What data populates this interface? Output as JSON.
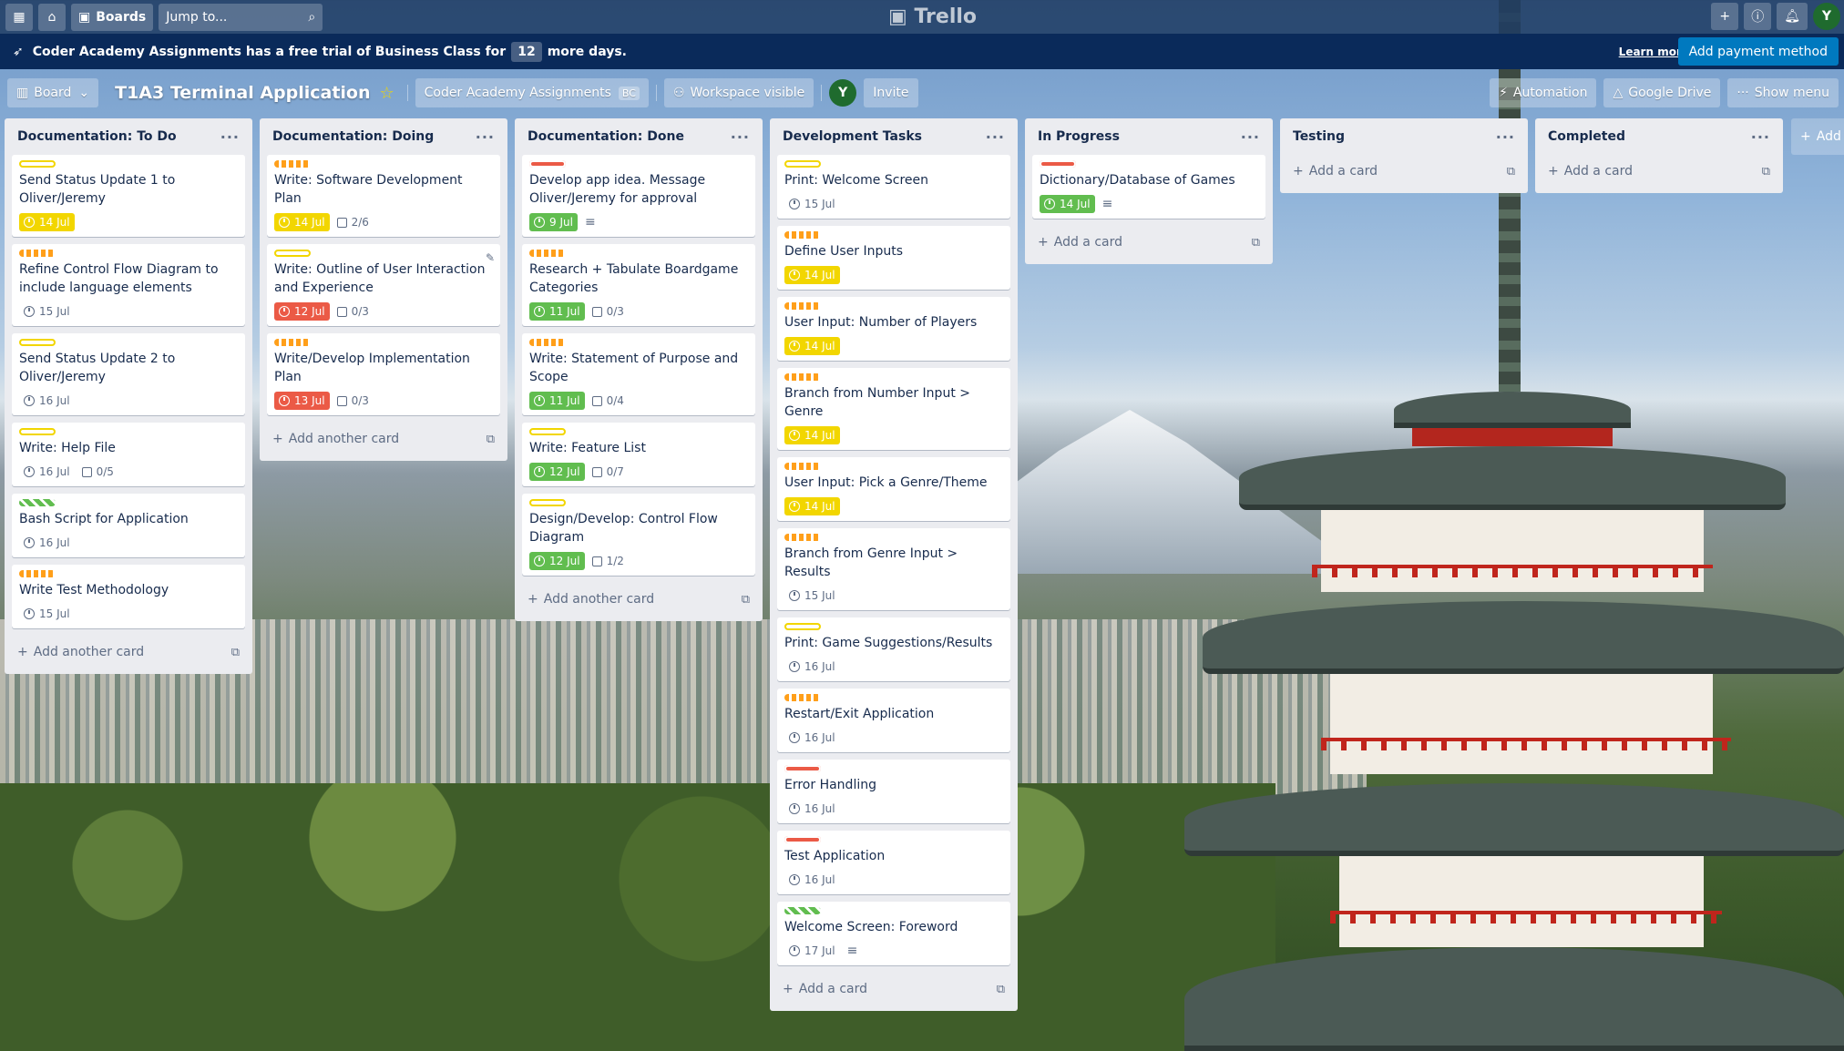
{
  "topbar": {
    "apps_icon": "grid-icon",
    "home_icon": "home-icon",
    "boards_label": "Boards",
    "search_placeholder": "Jump to...",
    "logo": "Trello",
    "right_icons": [
      "plus-icon",
      "info-icon",
      "bell-icon"
    ],
    "avatar_initial": "Y"
  },
  "banner": {
    "text_before": "Coder Academy Assignments has a free trial of Business Class for",
    "days": "12",
    "text_after": "more days.",
    "learn_more": "Learn more",
    "payment_button": "Add payment method"
  },
  "board_header": {
    "view_label": "Board",
    "title": "T1A3 Terminal Application",
    "workspace": "Coder Academy Assignments",
    "workspace_badge": "BC",
    "visibility": "Workspace visible",
    "member_initial": "Y",
    "invite": "Invite",
    "automation": "Automation",
    "google_drive": "Google Drive",
    "show_menu": "Show menu"
  },
  "colors": {
    "yellow": "#f2d600",
    "orange": "#ff9f1a",
    "red": "#eb5a46",
    "green": "#61bd4f",
    "list_bg": "#ebecf0",
    "payment": "#0079bf"
  },
  "lists": [
    {
      "title": "Documentation: To Do",
      "add_label": "Add another card",
      "cards": [
        {
          "label": "yellow",
          "title": "Send Status Update 1 to Oliver/Jeremy",
          "due": "14 Jul",
          "due_style": "yellow",
          "checklist": ""
        },
        {
          "label": "orange",
          "title": "Refine Control Flow Diagram to include language elements",
          "due": "15 Jul",
          "due_style": "plain",
          "checklist": ""
        },
        {
          "label": "yellow",
          "title": "Send Status Update 2 to Oliver/Jeremy",
          "due": "16 Jul",
          "due_style": "plain",
          "checklist": ""
        },
        {
          "label": "yellow",
          "title": "Write: Help File",
          "due": "16 Jul",
          "due_style": "plain",
          "checklist": "0/5"
        },
        {
          "label": "green",
          "title": "Bash Script for Application",
          "due": "16 Jul",
          "due_style": "plain",
          "checklist": ""
        },
        {
          "label": "orange",
          "title": "Write Test Methodology",
          "due": "15 Jul",
          "due_style": "plain",
          "checklist": ""
        }
      ]
    },
    {
      "title": "Documentation: Doing",
      "add_label": "Add another card",
      "cards": [
        {
          "label": "orange",
          "title": "Write: Software Development Plan",
          "due": "14 Jul",
          "due_style": "yellow",
          "checklist": "2/6"
        },
        {
          "label": "yellow",
          "title": "Write: Outline of User Interaction and Experience",
          "due": "12 Jul",
          "due_style": "red",
          "checklist": "0/3"
        },
        {
          "label": "orange",
          "title": "Write/Develop Implementation Plan",
          "due": "13 Jul",
          "due_style": "red",
          "checklist": "0/3"
        }
      ]
    },
    {
      "title": "Documentation: Done",
      "add_label": "Add another card",
      "cards": [
        {
          "label": "red",
          "title": "Develop app idea. Message Oliver/Jeremy for approval",
          "due": "9 Jul",
          "due_style": "green",
          "checklist": "",
          "has_desc": true
        },
        {
          "label": "orange",
          "title": "Research + Tabulate Boardgame Categories",
          "due": "11 Jul",
          "due_style": "green",
          "checklist": "0/3"
        },
        {
          "label": "orange",
          "title": "Write: Statement of Purpose and Scope",
          "due": "11 Jul",
          "due_style": "green",
          "checklist": "0/4"
        },
        {
          "label": "yellow",
          "title": "Write: Feature List",
          "due": "12 Jul",
          "due_style": "green",
          "checklist": "0/7"
        },
        {
          "label": "yellow",
          "title": "Design/Develop: Control Flow Diagram",
          "due": "12 Jul",
          "due_style": "green",
          "checklist": "1/2"
        }
      ]
    },
    {
      "title": "Development Tasks",
      "add_label": "Add a card",
      "cards": [
        {
          "label": "yellow",
          "title": "Print: Welcome Screen",
          "due": "15 Jul",
          "due_style": "plain",
          "checklist": ""
        },
        {
          "label": "orange",
          "title": "Define User Inputs",
          "due": "14 Jul",
          "due_style": "yellow",
          "checklist": ""
        },
        {
          "label": "orange",
          "title": "User Input: Number of Players",
          "due": "14 Jul",
          "due_style": "yellow",
          "checklist": ""
        },
        {
          "label": "orange",
          "title": "Branch from Number Input > Genre",
          "due": "14 Jul",
          "due_style": "yellow",
          "checklist": ""
        },
        {
          "label": "orange",
          "title": "User Input: Pick a Genre/Theme",
          "due": "14 Jul",
          "due_style": "yellow",
          "checklist": ""
        },
        {
          "label": "orange",
          "title": "Branch from Genre Input > Results",
          "due": "15 Jul",
          "due_style": "plain",
          "checklist": ""
        },
        {
          "label": "yellow",
          "title": "Print: Game Suggestions/Results",
          "due": "16 Jul",
          "due_style": "plain",
          "checklist": ""
        },
        {
          "label": "orange",
          "title": "Restart/Exit Application",
          "due": "16 Jul",
          "due_style": "plain",
          "checklist": ""
        },
        {
          "label": "red",
          "title": "Error Handling",
          "due": "16 Jul",
          "due_style": "plain",
          "checklist": ""
        },
        {
          "label": "red",
          "title": "Test Application",
          "due": "16 Jul",
          "due_style": "plain",
          "checklist": ""
        },
        {
          "label": "green",
          "title": "Welcome Screen: Foreword",
          "due": "17 Jul",
          "due_style": "plain",
          "checklist": "",
          "has_desc": true
        }
      ]
    },
    {
      "title": "In Progress",
      "add_label": "Add a card",
      "cards": [
        {
          "label": "red",
          "title": "Dictionary/Database of Games",
          "due": "14 Jul",
          "due_style": "green",
          "checklist": "",
          "has_desc": true
        }
      ]
    },
    {
      "title": "Testing",
      "add_label": "Add a card",
      "cards": []
    },
    {
      "title": "Completed",
      "add_label": "Add a card",
      "cards": []
    }
  ],
  "add_list_label": "Add"
}
